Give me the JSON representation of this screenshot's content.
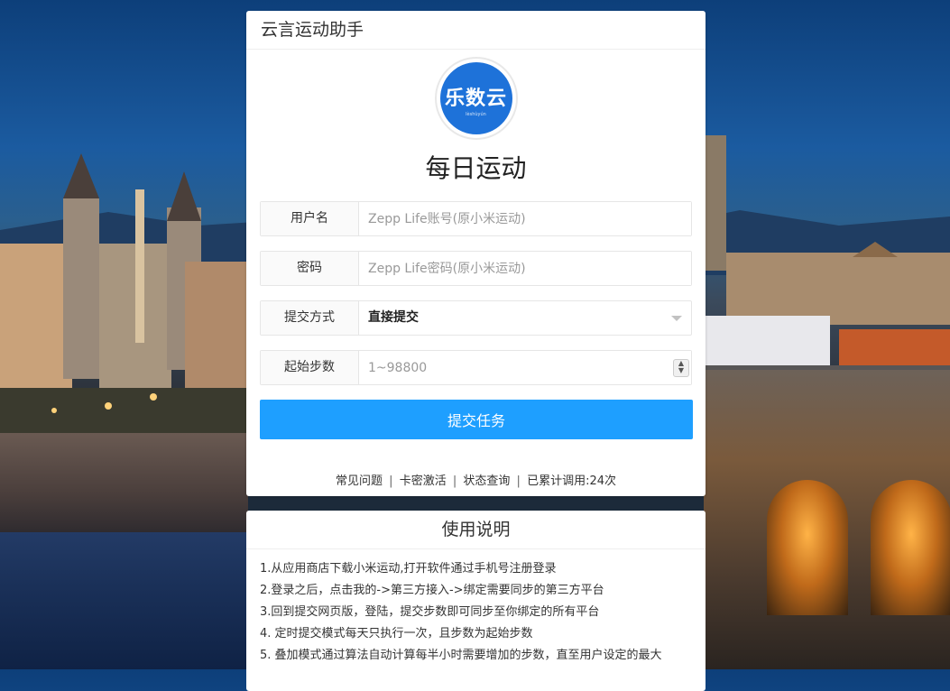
{
  "app": {
    "header_title": "云言运动助手",
    "logo_text": "乐数云",
    "logo_sub": "lèshùyún",
    "page_title": "每日运动"
  },
  "form": {
    "username": {
      "label": "用户名",
      "placeholder": "Zepp Life账号(原小米运动)"
    },
    "password": {
      "label": "密码",
      "placeholder": "Zepp Life密码(原小米运动)"
    },
    "submit_mode": {
      "label": "提交方式",
      "value": "直接提交"
    },
    "start_steps": {
      "label": "起始步数",
      "placeholder": "1~98800"
    },
    "submit_label": "提交任务"
  },
  "footer_links": {
    "faq": "常见问题",
    "activate": "卡密激活",
    "status": "状态查询",
    "usage_count": "已累计调用:24次",
    "separator": "|"
  },
  "instructions": {
    "title": "使用说明",
    "steps": [
      "1.从应用商店下载小米运动,打开软件通过手机号注册登录",
      "2.登录之后，点击我的->第三方接入->绑定需要同步的第三方平台",
      "3.回到提交网页版，登陆，提交步数即可同步至你绑定的所有平台",
      "4. 定时提交模式每天只执行一次，且步数为起始步数",
      "5. 叠加模式通过算法自动计算每半小时需要增加的步数，直至用户设定的最大"
    ]
  },
  "colors": {
    "primary_button": "#1e9fff",
    "logo_bg": "#1e72d9"
  }
}
